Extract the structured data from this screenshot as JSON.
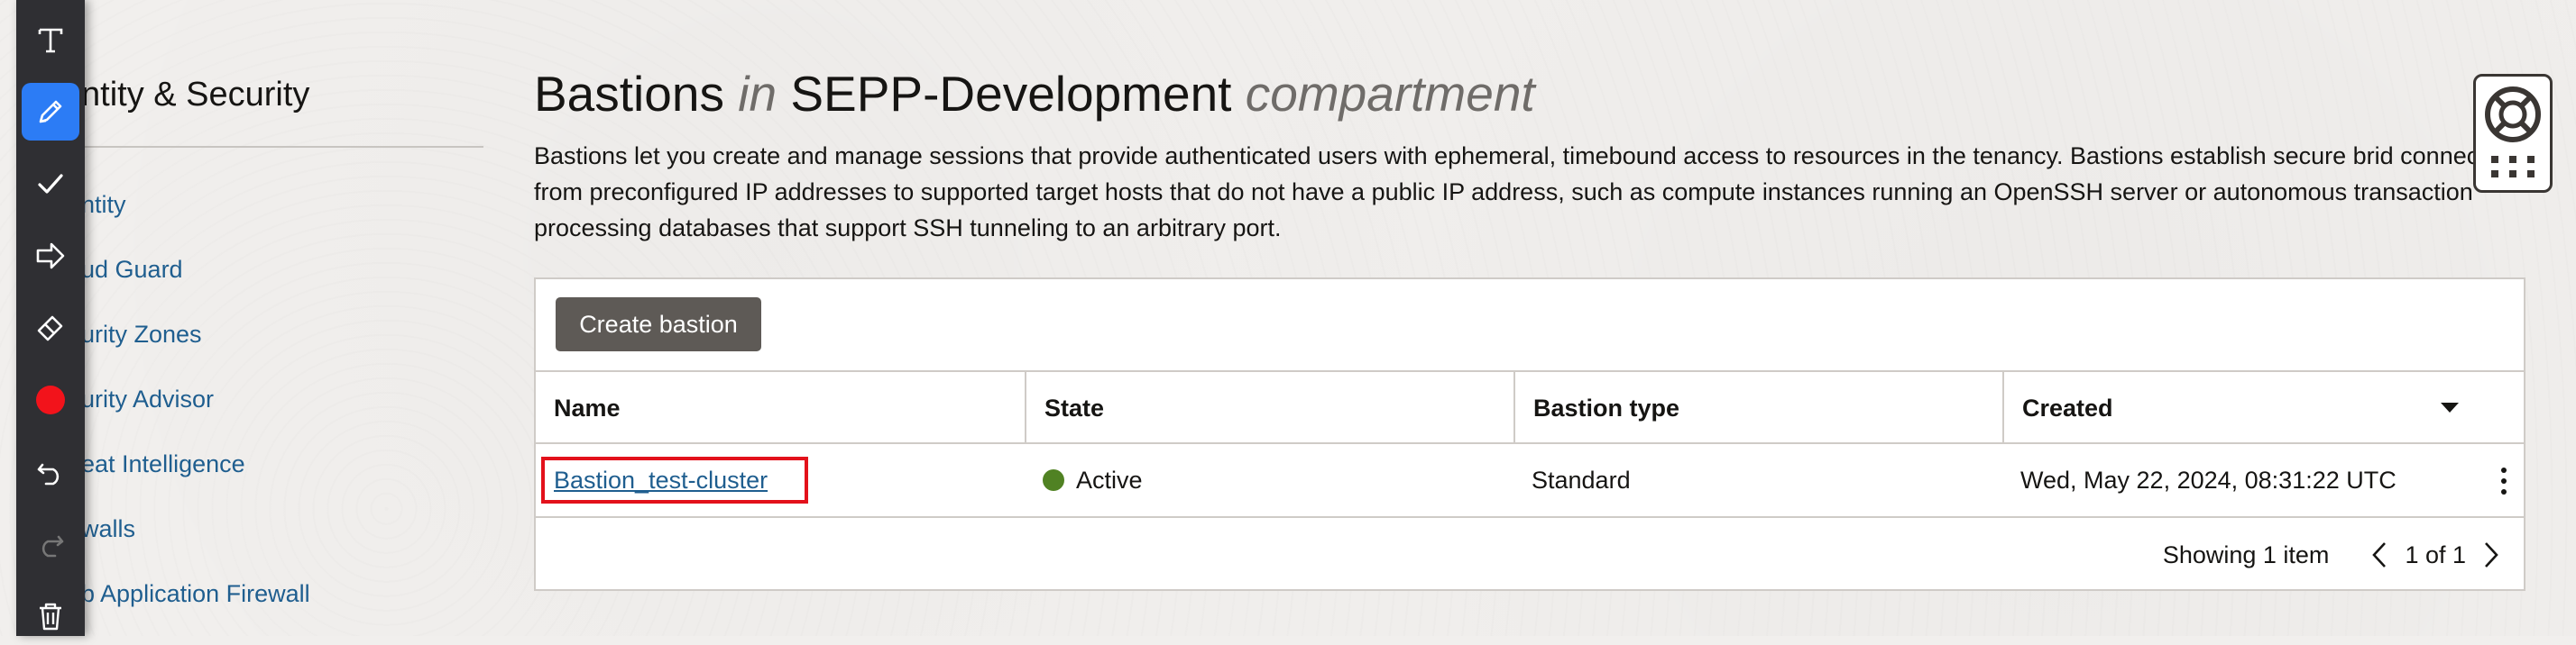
{
  "sidebar": {
    "title": "ntity & Security",
    "items": [
      {
        "label": "ntity"
      },
      {
        "label": "ud Guard"
      },
      {
        "label": "urity Zones"
      },
      {
        "label": "urity Advisor"
      },
      {
        "label": "eat Intelligence"
      },
      {
        "label": "walls"
      },
      {
        "label": "b Application Firewall"
      }
    ]
  },
  "header": {
    "title_main": "Bastions",
    "title_in": "in",
    "title_compartment_name": "SEPP-Development",
    "title_suffix": "compartment",
    "description": "Bastions let you create and manage sessions that provide authenticated users with ephemeral, timebound access to resources in the tenancy. Bastions establish secure brid connections from preconfigured IP addresses to supported target hosts that do not have a public IP address, such as compute instances running an OpenSSH server or autonomous transaction processing databases that support SSH tunneling to an arbitrary port."
  },
  "toolbar": {
    "create_label": "Create bastion"
  },
  "table": {
    "columns": [
      "Name",
      "State",
      "Bastion type",
      "Created"
    ],
    "rows": [
      {
        "name": "Bastion_test-cluster",
        "state": "Active",
        "bastion_type": "Standard",
        "created": "Wed, May 22, 2024, 08:31:22 UTC"
      }
    ],
    "showing": "Showing 1 item",
    "page": "1 of 1"
  },
  "colors": {
    "accent_blue": "#2c7cf5",
    "link": "#1f5e8f",
    "active_green": "#508223",
    "highlight_red": "#e3111b",
    "button_bg": "#5e5a56"
  },
  "annotation_tools": [
    "text-icon",
    "pencil-icon",
    "check-icon",
    "arrow-icon",
    "eraser-icon",
    "red-color-swatch",
    "undo-icon",
    "redo-icon",
    "trash-icon"
  ]
}
